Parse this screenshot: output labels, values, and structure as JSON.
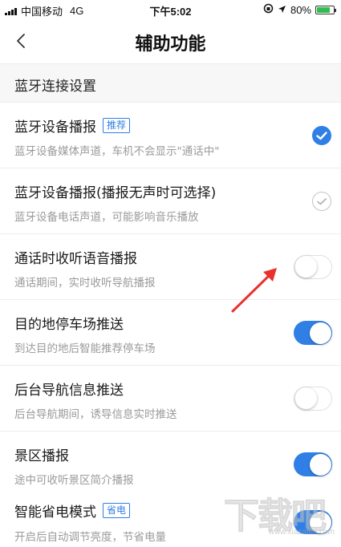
{
  "status_bar": {
    "carrier": "中国移动",
    "network": "4G",
    "time": "下午5:02",
    "battery_text": "80%",
    "battery_level": 0.8
  },
  "nav": {
    "title": "辅助功能"
  },
  "section": {
    "header": "蓝牙连接设置"
  },
  "settings": [
    {
      "title": "蓝牙设备播报",
      "tag": "推荐",
      "subtitle": "蓝牙设备媒体声道，车机不会显示\"通话中\"",
      "control": "check",
      "state": true
    },
    {
      "title": "蓝牙设备播报(播报无声时可选择)",
      "tag": "",
      "subtitle": "蓝牙设备电话声道，可能影响音乐播放",
      "control": "check",
      "state": false
    },
    {
      "title": "通话时收听语音播报",
      "tag": "",
      "subtitle": "通话期间，实时收听导航播报",
      "control": "toggle",
      "state": false
    },
    {
      "title": "目的地停车场推送",
      "tag": "",
      "subtitle": "到达目的地后智能推荐停车场",
      "control": "toggle",
      "state": true
    },
    {
      "title": "后台导航信息推送",
      "tag": "",
      "subtitle": "后台导航期间，诱导信息实时推送",
      "control": "toggle",
      "state": false
    },
    {
      "title": "景区播报",
      "tag": "",
      "subtitle": "途中可收听景区简介播报",
      "control": "toggle",
      "state": true
    },
    {
      "title": "智能省电模式",
      "tag": "省电",
      "subtitle": "开启后自动调节亮度，节省电量",
      "control": "toggle",
      "state": true
    }
  ],
  "watermark": {
    "big": "下载吧",
    "small": "www.xiazaiba.com"
  },
  "colors": {
    "accent": "#2f7fe6",
    "annotation_arrow": "#e8322d",
    "battery": "#2ec04f"
  },
  "icons": {
    "back": "chevron-left-icon",
    "check_on": "check-circle-filled-icon",
    "check_off": "check-circle-outline-icon"
  }
}
